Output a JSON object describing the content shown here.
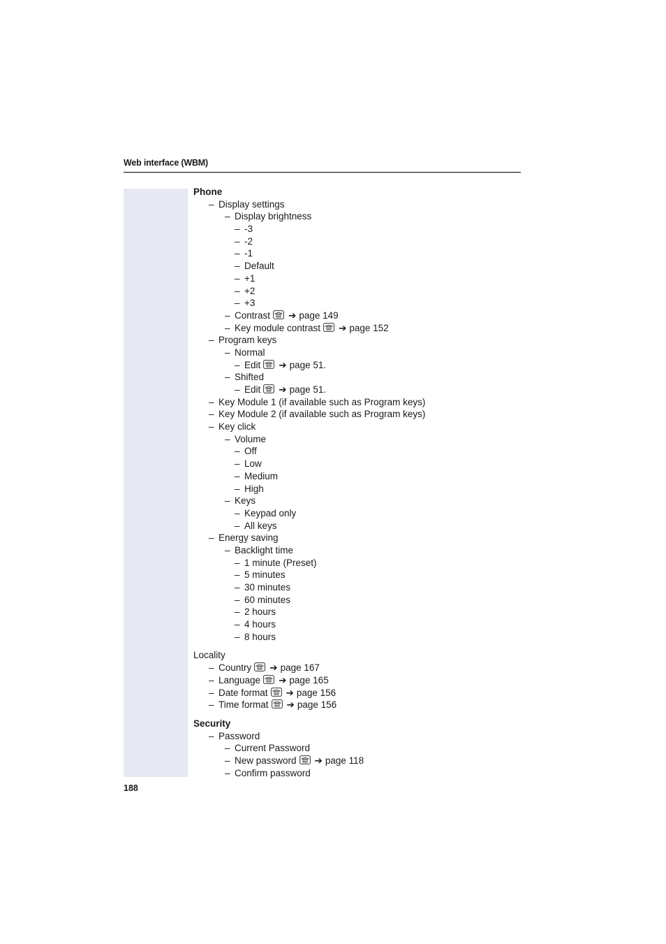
{
  "header": {
    "title": "Web interface (WBM)"
  },
  "page_number": "188",
  "sections": [
    {
      "title": "Phone",
      "bold": true,
      "items": [
        {
          "level": 1,
          "text": "Display settings"
        },
        {
          "level": 2,
          "text": "Display brightness"
        },
        {
          "level": 3,
          "text": "-3"
        },
        {
          "level": 3,
          "text": "-2"
        },
        {
          "level": 3,
          "text": "-1"
        },
        {
          "level": 3,
          "text": "Default"
        },
        {
          "level": 3,
          "text": "+1"
        },
        {
          "level": 3,
          "text": "+2"
        },
        {
          "level": 3,
          "text": "+3"
        },
        {
          "level": 2,
          "text": "Contrast",
          "ref": "page 149"
        },
        {
          "level": 2,
          "text": "Key module contrast",
          "ref": "page 152"
        },
        {
          "level": 1,
          "text": "Program keys"
        },
        {
          "level": 2,
          "text": "Normal"
        },
        {
          "level": 3,
          "text": "Edit",
          "ref": "page 51."
        },
        {
          "level": 2,
          "text": "Shifted"
        },
        {
          "level": 3,
          "text": "Edit",
          "ref": "page 51."
        },
        {
          "level": 1,
          "text": "Key Module 1 (if available such as Program keys)"
        },
        {
          "level": 1,
          "text": "Key Module 2 (if available such as Program keys)"
        },
        {
          "level": 1,
          "text": "Key click"
        },
        {
          "level": 2,
          "text": "Volume"
        },
        {
          "level": 3,
          "text": "Off"
        },
        {
          "level": 3,
          "text": "Low"
        },
        {
          "level": 3,
          "text": "Medium"
        },
        {
          "level": 3,
          "text": "High"
        },
        {
          "level": 2,
          "text": "Keys"
        },
        {
          "level": 3,
          "text": "Keypad only"
        },
        {
          "level": 3,
          "text": "All keys"
        },
        {
          "level": 1,
          "text": "Energy saving"
        },
        {
          "level": 2,
          "text": "Backlight time"
        },
        {
          "level": 3,
          "text": "1 minute (Preset)"
        },
        {
          "level": 3,
          "text": "5 minutes"
        },
        {
          "level": 3,
          "text": "30 minutes"
        },
        {
          "level": 3,
          "text": "60 minutes"
        },
        {
          "level": 3,
          "text": "2 hours"
        },
        {
          "level": 3,
          "text": "4 hours"
        },
        {
          "level": 3,
          "text": "8 hours"
        }
      ]
    },
    {
      "title": "Locality",
      "bold": false,
      "items": [
        {
          "level": 1,
          "text": "Country",
          "ref": "page 167"
        },
        {
          "level": 1,
          "text": "Language",
          "ref": "page 165"
        },
        {
          "level": 1,
          "text": "Date format",
          "ref": "page 156"
        },
        {
          "level": 1,
          "text": "Time format",
          "ref": "page 156"
        }
      ]
    },
    {
      "title": "Security",
      "bold": true,
      "items": [
        {
          "level": 1,
          "text": "Password"
        },
        {
          "level": 2,
          "text": "Current Password"
        },
        {
          "level": 2,
          "text": "New password",
          "ref": "page 118"
        },
        {
          "level": 2,
          "text": "Confirm password"
        }
      ]
    }
  ],
  "symbols": {
    "dash": "–",
    "arrow": "➔",
    "phone_icon": "telephone-icon"
  }
}
